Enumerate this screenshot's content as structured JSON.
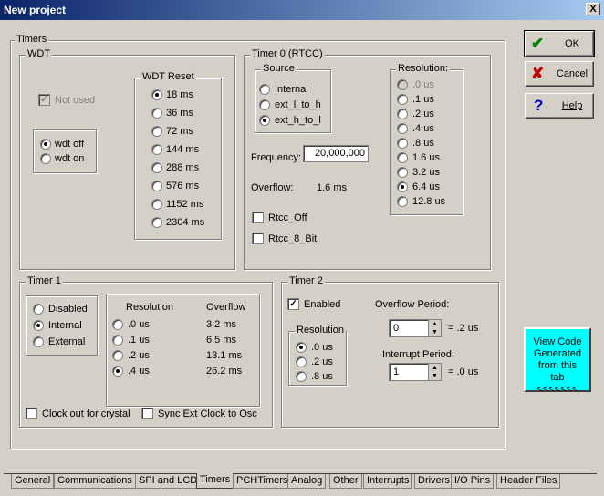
{
  "window": {
    "title": "New project",
    "close": "X"
  },
  "buttons": {
    "ok": "OK",
    "cancel": "Cancel",
    "help": "Help"
  },
  "timers": {
    "label": "Timers"
  },
  "wdt": {
    "label": "WDT",
    "not_used": "Not used",
    "wdt_off": "wdt off",
    "wdt_on": "wdt on",
    "reset_label": "WDT Reset",
    "reset": [
      "18 ms",
      "36 ms",
      "72 ms",
      "144 ms",
      "288 ms",
      "576 ms",
      "1152 ms",
      "2304 ms"
    ]
  },
  "timer0": {
    "label": "Timer 0 (RTCC)",
    "source_label": "Source",
    "source": [
      "Internal",
      "ext_l_to_h",
      "ext_h_to_l"
    ],
    "resolution_label": "Resolution:",
    "resolution": [
      ".0 us",
      ".1 us",
      ".2 us",
      ".4 us",
      ".8 us",
      "1.6 us",
      "3.2 us",
      "6.4 us",
      "12.8 us"
    ],
    "frequency_label": "Frequency:",
    "frequency": "20,000,000",
    "overflow_label": "Overflow:",
    "overflow": "1.6 ms",
    "rtcc_off": "Rtcc_Off",
    "rtcc_8bit": "Rtcc_8_Bit"
  },
  "timer1": {
    "label": "Timer 1",
    "modes": [
      "Disabled",
      "Internal",
      "External"
    ],
    "res_header": "Resolution",
    "ovf_header": "Overflow",
    "rows": [
      {
        "res": ".0 us",
        "ovf": "3.2 ms"
      },
      {
        "res": ".1 us",
        "ovf": "6.5 ms"
      },
      {
        "res": ".2 us",
        "ovf": "13.1 ms"
      },
      {
        "res": ".4 us",
        "ovf": "26.2 ms"
      }
    ],
    "clock_out": "Clock out for crystal",
    "sync": "Sync Ext Clock to Osc"
  },
  "timer2": {
    "label": "Timer 2",
    "enabled": "Enabled",
    "resolution_label": "Resolution",
    "resolution": [
      ".0 us",
      ".2 us",
      ".8 us"
    ],
    "overflow_label": "Overflow Period:",
    "overflow_value": "0",
    "overflow_result": "= .2 us",
    "interrupt_label": "Interrupt Period:",
    "interrupt_value": "1",
    "interrupt_result": "= .0 us"
  },
  "view_code": "View Code Generated from this tab <<<<<<<",
  "tabs": [
    "General",
    "Communications",
    "SPI and LCD",
    "Timers",
    "PCHTimers",
    "Analog",
    "Other",
    "Interrupts",
    "Drivers",
    "I/O Pins",
    "Header Files"
  ],
  "colors": {
    "title_start": "#0a246a",
    "title_end": "#a6caf0",
    "view_code_bg": "#00ffff",
    "check_green": "#008000",
    "cancel_red": "#c00000",
    "help_blue": "#0000c0"
  }
}
